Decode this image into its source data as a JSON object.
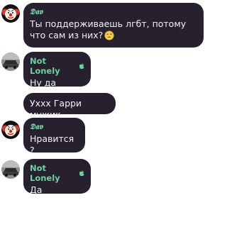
{
  "messages": [
    {
      "author": "𝕯𝖆𝖛",
      "text": "Ты поддерживаешь лгбт, потому что сам из них?",
      "emoji_icon": "grinning-sweat-emoji"
    },
    {
      "author": "Not Lonely",
      "badge_icon": "apple-icon",
      "text": "Ну да"
    },
    {
      "text": "Уххх Гарри мужик"
    },
    {
      "author": "𝕯𝖆𝖛",
      "text": "Нравится ?"
    },
    {
      "author": "Not Lonely",
      "badge_icon": "apple-icon",
      "text": "Да"
    }
  ],
  "colors": {
    "bubble": "#27202f",
    "author_name": "#6fd0a0",
    "text": "#f2f2f2"
  }
}
